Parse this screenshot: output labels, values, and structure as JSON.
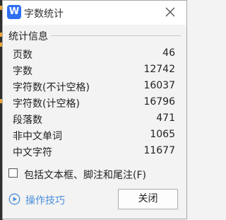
{
  "window": {
    "title": "字数统计",
    "app_icon_letter": "W",
    "accent": "#2f6ff0"
  },
  "section": {
    "label": "统计信息"
  },
  "stats": [
    {
      "label": "页数",
      "value": "46"
    },
    {
      "label": "字数",
      "value": "12742"
    },
    {
      "label": "字符数(不计空格)",
      "value": "16037"
    },
    {
      "label": "字符数(计空格)",
      "value": "16796"
    },
    {
      "label": "段落数",
      "value": "471"
    },
    {
      "label": "非中文单词",
      "value": "1065"
    },
    {
      "label": "中文字符",
      "value": "11677"
    }
  ],
  "options": {
    "include_textbox_label": "包括文本框、脚注和尾注(F)",
    "include_textbox_checked": false
  },
  "footer": {
    "tips_label": "操作技巧",
    "close_label": "关闭",
    "tips_color": "#4a8fd8"
  }
}
